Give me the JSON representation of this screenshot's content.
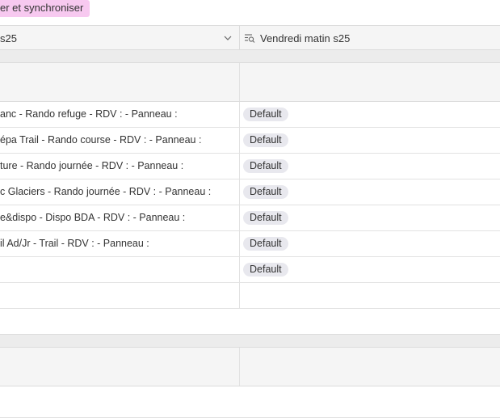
{
  "sync_tag": {
    "label": "er et synchroniser"
  },
  "header": {
    "col1_label": "s25",
    "col2_label": "Vendredi matin s25"
  },
  "rows": [
    {
      "text": "anc - Rando refuge - RDV : - Panneau :",
      "badge": "Default"
    },
    {
      "text": "épa Trail - Rando course - RDV : - Panneau :",
      "badge": "Default"
    },
    {
      "text": "ture - Rando journée - RDV : - Panneau :",
      "badge": "Default"
    },
    {
      "text": "c Glaciers - Rando journée - RDV : - Panneau :",
      "badge": "Default"
    },
    {
      "text": "e&dispo - Dispo BDA - RDV : - Panneau :",
      "badge": "Default"
    },
    {
      "text": "il Ad/Jr - Trail - RDV : - Panneau :",
      "badge": "Default"
    },
    {
      "text": "",
      "badge": "Default"
    }
  ],
  "icons": {
    "col1_chevron": "chevron-down-icon",
    "col2_icon": "lookup-field-icon"
  },
  "colors": {
    "sync_tag_bg": "#f7c9f0",
    "badge_bg": "#e8e8ee"
  }
}
